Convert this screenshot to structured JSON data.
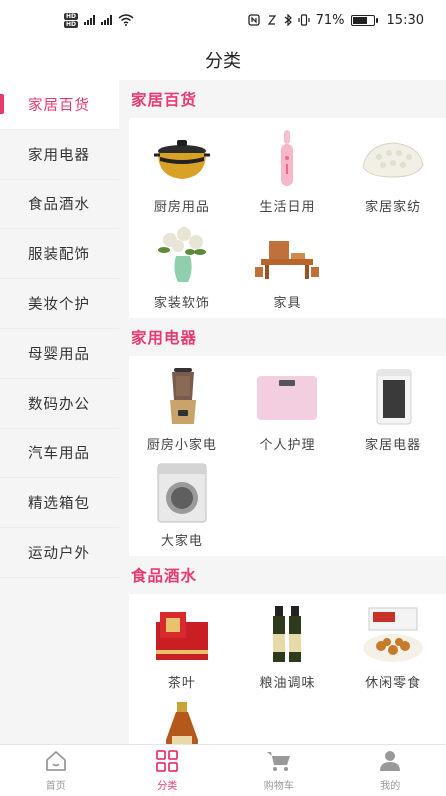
{
  "status_bar": {
    "battery": "71%",
    "time": "15:30",
    "battery_level": 0.71
  },
  "header": {
    "title": "分类"
  },
  "sidebar": {
    "items": [
      {
        "label": "家居百货",
        "active": true
      },
      {
        "label": "家用电器"
      },
      {
        "label": "食品酒水"
      },
      {
        "label": "服装配饰"
      },
      {
        "label": "美妆个护"
      },
      {
        "label": "母婴用品"
      },
      {
        "label": "数码办公"
      },
      {
        "label": "汽车用品"
      },
      {
        "label": "精选箱包"
      },
      {
        "label": "运动户外"
      }
    ]
  },
  "sections": [
    {
      "title": "家居百货",
      "items": [
        {
          "label": "厨房用品",
          "icon": "casserole-pot-icon"
        },
        {
          "label": "生活日用",
          "icon": "electric-toothbrush-icon"
        },
        {
          "label": "家居家纺",
          "icon": "latex-pillow-icon"
        },
        {
          "label": "家装软饰",
          "icon": "flower-vase-icon"
        },
        {
          "label": "家具",
          "icon": "tea-table-furniture-icon"
        }
      ]
    },
    {
      "title": "家用电器",
      "items": [
        {
          "label": "厨房小家电",
          "icon": "blender-icon"
        },
        {
          "label": "个人护理",
          "icon": "body-scale-icon"
        },
        {
          "label": "家居电器",
          "icon": "air-purifier-icon"
        },
        {
          "label": "大家电",
          "icon": "washing-machine-icon"
        }
      ]
    },
    {
      "title": "食品酒水",
      "items": [
        {
          "label": "茶叶",
          "icon": "tea-gift-box-icon"
        },
        {
          "label": "粮油调味",
          "icon": "oil-bottles-icon"
        },
        {
          "label": "休闲零食",
          "icon": "snack-box-icon"
        },
        {
          "label": "",
          "icon": "liquor-bottle-icon"
        }
      ]
    }
  ],
  "bottom_nav": {
    "items": [
      {
        "label": "首页",
        "icon": "home-icon"
      },
      {
        "label": "分类",
        "icon": "category-grid-icon",
        "active": true
      },
      {
        "label": "购物车",
        "icon": "cart-icon"
      },
      {
        "label": "我的",
        "icon": "user-icon"
      }
    ]
  },
  "colors": {
    "accent": "#e93a6f",
    "inactive": "#999999"
  }
}
